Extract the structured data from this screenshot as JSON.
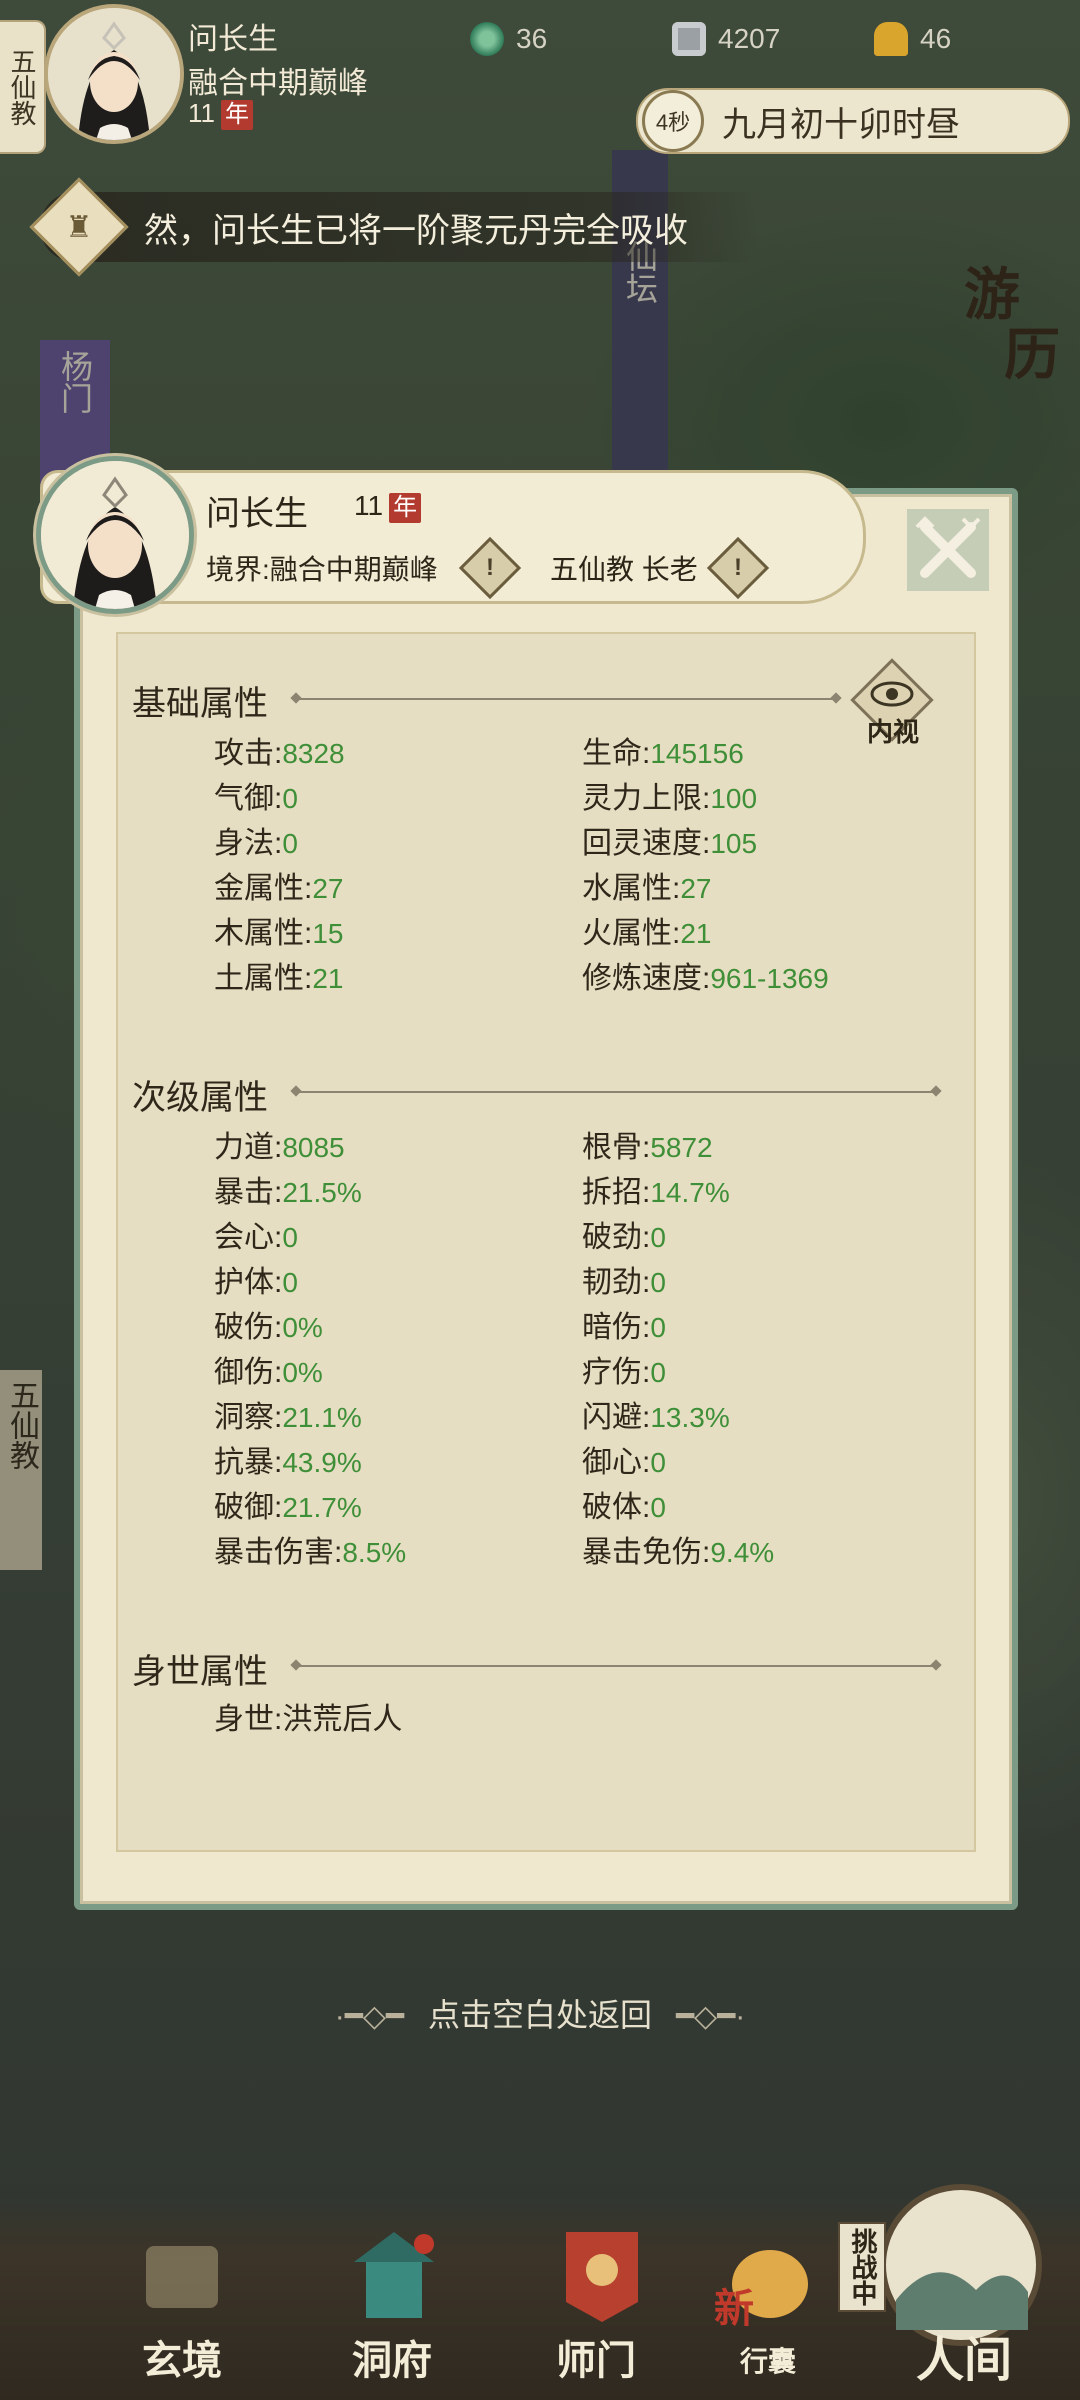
{
  "hud": {
    "sect_tab": "五仙教",
    "name": "问长生",
    "realm": "融合中期巅峰",
    "age": "11",
    "nian": "年",
    "resources": [
      {
        "icon": "jade-icon",
        "value": "36"
      },
      {
        "icon": "coin-icon",
        "value": "4207"
      },
      {
        "icon": "gold-ingot-icon",
        "value": "46"
      }
    ],
    "time_seconds": "4秒",
    "game_time": "九月初十卯时昼"
  },
  "notice": {
    "text": "然，问长生已将一阶聚元丹完全吸收"
  },
  "map_labels": {
    "left_banner_1": "杨门",
    "left_banner_2": "五仙教",
    "right_glyph_1": "游",
    "right_glyph_2": "历",
    "center_banner": "仙坛"
  },
  "profile": {
    "name": "问长生",
    "age": "11",
    "nian": "年",
    "realm_label": "境界:",
    "realm": "融合中期巅峰",
    "sect": "五仙教 长老",
    "inner_view": "内视"
  },
  "sections": {
    "basic": {
      "title": "基础属性",
      "left": [
        {
          "label": "攻击",
          "value": "8328"
        },
        {
          "label": "气御",
          "value": "0"
        },
        {
          "label": "身法",
          "value": "0"
        },
        {
          "label": "金属性",
          "value": "27"
        },
        {
          "label": "木属性",
          "value": "15"
        },
        {
          "label": "土属性",
          "value": "21"
        }
      ],
      "right": [
        {
          "label": "生命",
          "value": "145156"
        },
        {
          "label": "灵力上限",
          "value": "100"
        },
        {
          "label": "回灵速度",
          "value": "105"
        },
        {
          "label": "水属性",
          "value": "27"
        },
        {
          "label": "火属性",
          "value": "21"
        },
        {
          "label": "修炼速度",
          "value": "961-1369"
        }
      ]
    },
    "secondary": {
      "title": "次级属性",
      "left": [
        {
          "label": "力道",
          "value": "8085"
        },
        {
          "label": "暴击",
          "value": "21.5%"
        },
        {
          "label": "会心",
          "value": "0"
        },
        {
          "label": "护体",
          "value": "0"
        },
        {
          "label": "破伤",
          "value": "0%"
        },
        {
          "label": "御伤",
          "value": "0%"
        },
        {
          "label": "洞察",
          "value": "21.1%"
        },
        {
          "label": "抗暴",
          "value": "43.9%"
        },
        {
          "label": "破御",
          "value": "21.7%"
        },
        {
          "label": "暴击伤害",
          "value": "8.5%"
        }
      ],
      "right": [
        {
          "label": "根骨",
          "value": "5872"
        },
        {
          "label": "拆招",
          "value": "14.7%"
        },
        {
          "label": "破劲",
          "value": "0"
        },
        {
          "label": "韧劲",
          "value": "0"
        },
        {
          "label": "暗伤",
          "value": "0"
        },
        {
          "label": "疗伤",
          "value": "0"
        },
        {
          "label": "闪避",
          "value": "13.3%"
        },
        {
          "label": "御心",
          "value": "0"
        },
        {
          "label": "破体",
          "value": "0"
        },
        {
          "label": "暴击免伤",
          "value": "9.4%"
        }
      ]
    },
    "origin": {
      "title": "身世属性",
      "label": "身世",
      "value": "洪荒后人"
    }
  },
  "footer_hint": "点击空白处返回",
  "nav": {
    "items": [
      "玄境",
      "洞府",
      "师门",
      "行囊",
      "人间"
    ],
    "badge_new": "新",
    "challenge": "挑战中"
  },
  "colors": {
    "panel_bg": "#efe8cf",
    "panel_border": "#7c9b86",
    "value_green": "#3f8f38",
    "nian_red": "#b23a2e"
  }
}
